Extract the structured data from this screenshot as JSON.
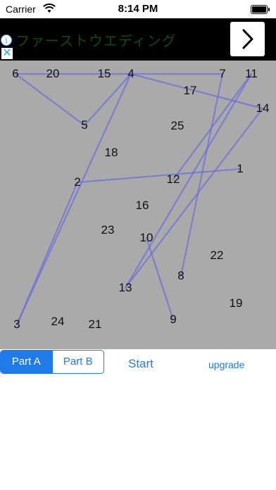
{
  "status_bar": {
    "carrier": "Carrier",
    "time": "8:14 PM"
  },
  "ad": {
    "text": "ファーストウエディング",
    "info_icon": "i",
    "close_icon": "✕",
    "next_icon": "chevron-right-icon"
  },
  "board": {
    "background": "#aaaaaa",
    "line_color": "#6f6fd8",
    "numbers": [
      "1",
      "2",
      "3",
      "4",
      "5",
      "6",
      "7",
      "8",
      "9",
      "10",
      "11",
      "12",
      "13",
      "14",
      "15",
      "16",
      "17",
      "18",
      "19",
      "20",
      "21",
      "22",
      "23",
      "24",
      "25"
    ],
    "connections": [
      [
        "6",
        "4"
      ],
      [
        "4",
        "7"
      ],
      [
        "6",
        "5"
      ],
      [
        "4",
        "5"
      ],
      [
        "4",
        "3"
      ],
      [
        "2",
        "3"
      ],
      [
        "2",
        "1"
      ],
      [
        "4",
        "14"
      ],
      [
        "11",
        "12"
      ],
      [
        "7",
        "8"
      ],
      [
        "11",
        "13"
      ],
      [
        "14",
        "13"
      ],
      [
        "10",
        "9"
      ]
    ]
  },
  "controls": {
    "segments": [
      "Part A",
      "Part B"
    ],
    "selected_segment": "Part A",
    "start_label": "Start",
    "upgrade_label": "upgrade"
  }
}
